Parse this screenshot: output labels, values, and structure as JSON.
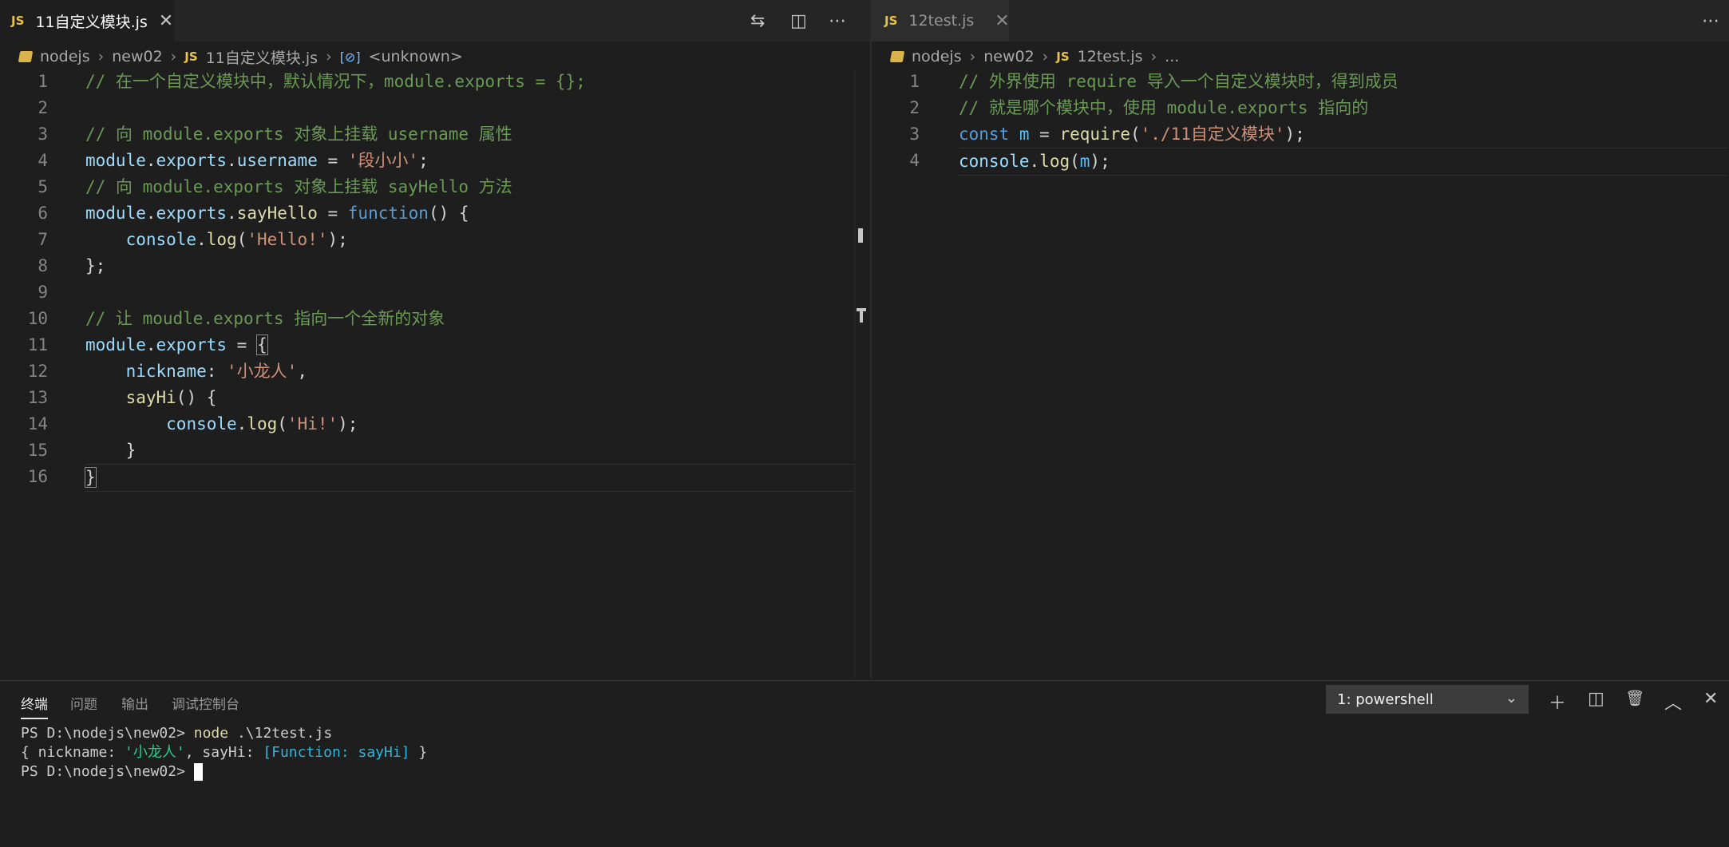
{
  "left_editor": {
    "tab": {
      "icon": "JS",
      "label": "11自定义模块.js",
      "close": "✕"
    },
    "breadcrumb": {
      "folder": "nodejs",
      "subfolder": "new02",
      "file_icon": "JS",
      "file": "11自定义模块.js",
      "symbol_icon": "[⊘]",
      "symbol": "<unknown>"
    },
    "line_numbers": [
      "1",
      "2",
      "3",
      "4",
      "5",
      "6",
      "7",
      "8",
      "9",
      "10",
      "11",
      "12",
      "13",
      "14",
      "15",
      "16"
    ]
  },
  "right_editor": {
    "tab": {
      "icon": "JS",
      "label": "12test.js",
      "close": "✕"
    },
    "breadcrumb": {
      "folder": "nodejs",
      "subfolder": "new02",
      "file_icon": "JS",
      "file": "12test.js",
      "ellipsis": "..."
    },
    "line_numbers": [
      "1",
      "2",
      "3",
      "4"
    ]
  },
  "code_left": {
    "l1": "// 在一个自定义模块中，默认情况下，module.exports = {};",
    "l3": "// 向 module.exports 对象上挂载 username 属性",
    "l4_a": "module",
    "l4_b": ".",
    "l4_c": "exports",
    "l4_d": ".",
    "l4_e": "username",
    "l4_f": " = ",
    "l4_g": "'段小小'",
    "l4_h": ";",
    "l5": "// 向 module.exports 对象上挂载 sayHello 方法",
    "l6_a": "module",
    "l6_b": ".",
    "l6_c": "exports",
    "l6_d": ".",
    "l6_e": "sayHello",
    "l6_f": " = ",
    "l6_g": "function",
    "l6_h": "() {",
    "l7_a": "    ",
    "l7_b": "console",
    "l7_c": ".",
    "l7_d": "log",
    "l7_e": "(",
    "l7_f": "'Hello!'",
    "l7_g": ");",
    "l8": "};",
    "l10": "// 让 moudle.exports 指向一个全新的对象",
    "l11_a": "module",
    "l11_b": ".",
    "l11_c": "exports",
    "l11_d": " = ",
    "l11_e": "{",
    "l12_a": "    ",
    "l12_b": "nickname",
    "l12_c": ": ",
    "l12_d": "'小龙人'",
    "l12_e": ",",
    "l13_a": "    ",
    "l13_b": "sayHi",
    "l13_c": "() {",
    "l14_a": "        ",
    "l14_b": "console",
    "l14_c": ".",
    "l14_d": "log",
    "l14_e": "(",
    "l14_f": "'Hi!'",
    "l14_g": ");",
    "l15": "    }",
    "l16": "}"
  },
  "code_right": {
    "l1": "// 外界使用 require 导入一个自定义模块时，得到成员",
    "l2": "// 就是哪个模块中，使用 module.exports 指向的",
    "l3_a": "const",
    "l3_b": " ",
    "l3_c": "m",
    "l3_d": " = ",
    "l3_e": "require",
    "l3_f": "(",
    "l3_g": "'./11自定义模块'",
    "l3_h": ");",
    "l4_a": "console",
    "l4_b": ".",
    "l4_c": "log",
    "l4_d": "(",
    "l4_e": "m",
    "l4_f": ");"
  },
  "panel": {
    "tabs": [
      "终端",
      "问题",
      "输出",
      "调试控制台"
    ],
    "terminal_select": "1: powershell",
    "icons": {
      "add": "＋",
      "split": "◫",
      "trash": "🗑",
      "maximize": "︿",
      "close": "✕"
    }
  },
  "terminal": {
    "line1_prompt": "PS D:\\nodejs\\new02> ",
    "line1_cmd": "node",
    "line1_arg": " .\\12test.js",
    "line2_a": "{ nickname: ",
    "line2_b": "'小龙人'",
    "line2_c": ", sayHi: ",
    "line2_d": "[Function: sayHi]",
    "line2_e": " }",
    "line3_prompt": "PS D:\\nodejs\\new02> "
  },
  "colors": {
    "background": "#1e1e1e",
    "comment": "#6a9955",
    "keyword": "#569cd6",
    "string": "#ce9178",
    "function": "#dcdcaa",
    "variable": "#9cdcfe"
  }
}
